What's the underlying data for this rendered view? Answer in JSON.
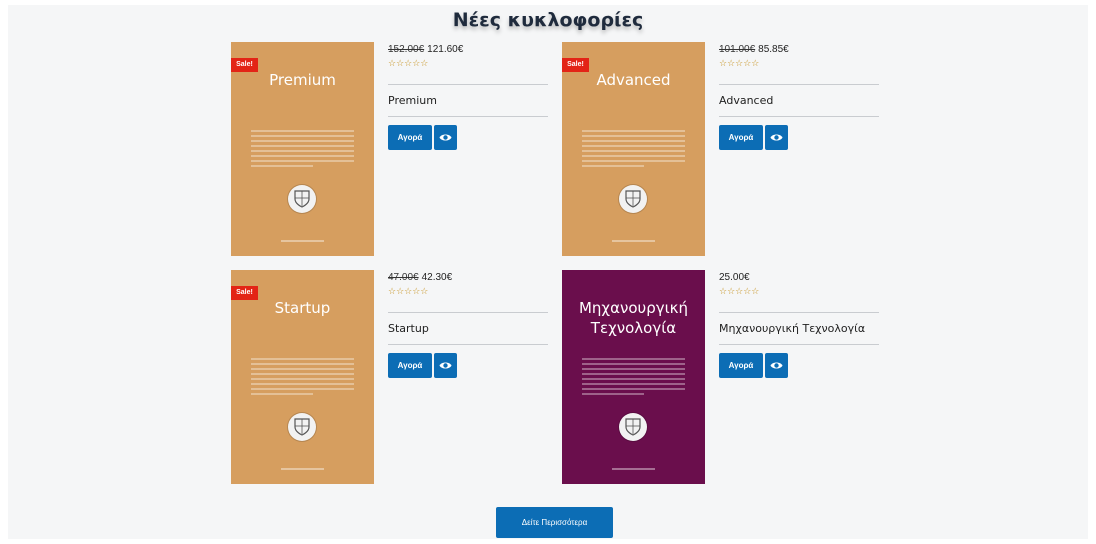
{
  "section": {
    "title": "Νέες κυκλοφορίες"
  },
  "products": [
    {
      "cover_title": "Premium",
      "cover_color": "#d69e5f",
      "sale_badge": "Sale!",
      "old_price": "152.00€",
      "price": "121.60€",
      "stars": "☆☆☆☆☆",
      "name": "Premium",
      "buy_label": "Αγορά",
      "view_icon": "eye-icon"
    },
    {
      "cover_title": "Advanced",
      "cover_color": "#d69e5f",
      "sale_badge": "Sale!",
      "old_price": "101.00€",
      "price": "85.85€",
      "stars": "☆☆☆☆☆",
      "name": "Advanced",
      "buy_label": "Αγορά",
      "view_icon": "eye-icon"
    },
    {
      "cover_title": "Startup",
      "cover_color": "#d69e5f",
      "sale_badge": "Sale!",
      "old_price": "47.00€",
      "price": "42.30€",
      "stars": "☆☆☆☆☆",
      "name": "Startup",
      "buy_label": "Αγορά",
      "view_icon": "eye-icon"
    },
    {
      "cover_title_line1": "Μηχανουργική",
      "cover_title_line2": "Τεχνολογία",
      "cover_color": "#6a0e4c",
      "price": "25.00€",
      "stars": "☆☆☆☆☆",
      "name": "Μηχανουργική Τεχνολογία",
      "buy_label": "Αγορά",
      "view_icon": "eye-icon"
    }
  ],
  "more_button": {
    "label": "Δείτε Περισσότερα"
  },
  "colors": {
    "accent": "#0c6db5",
    "sale": "#e32416",
    "background": "#f5f6f7"
  }
}
